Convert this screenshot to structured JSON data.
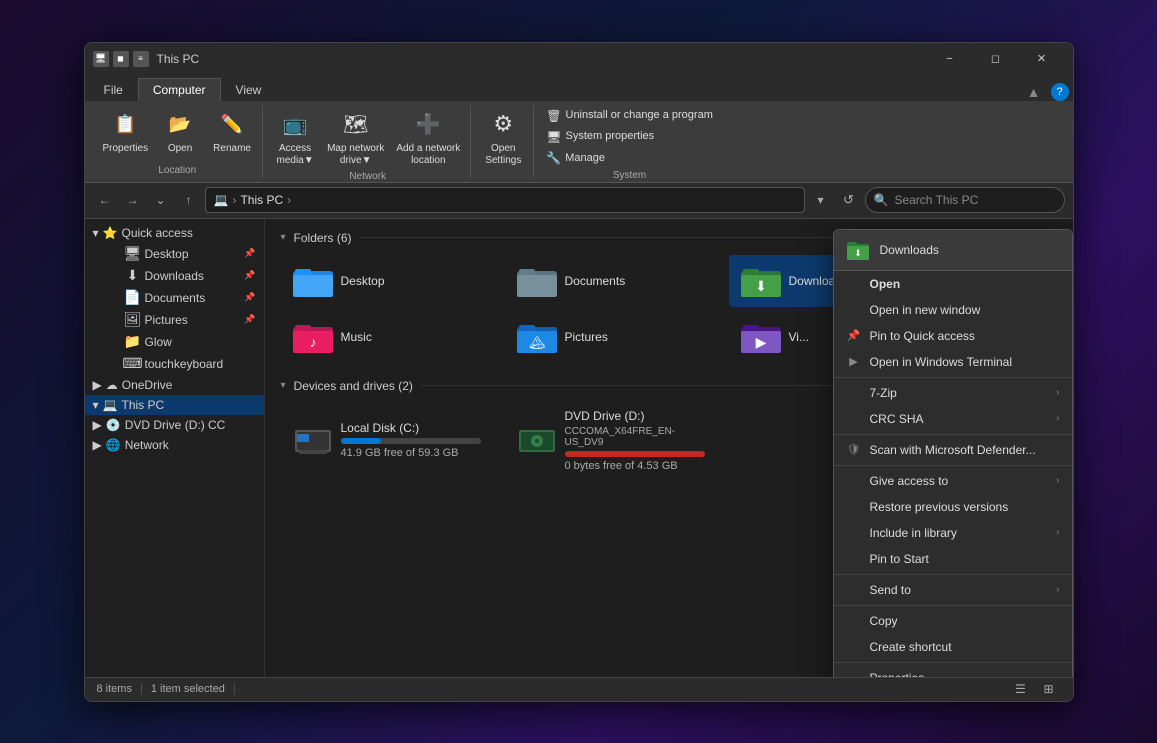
{
  "window": {
    "title": "This PC",
    "title_icon": "💻"
  },
  "ribbon_tabs": [
    {
      "label": "File",
      "active": false
    },
    {
      "label": "Computer",
      "active": true
    },
    {
      "label": "View",
      "active": false
    }
  ],
  "ribbon": {
    "location_group": {
      "label": "Location",
      "items": [
        {
          "icon": "📋",
          "label": "Properties"
        },
        {
          "icon": "📂",
          "label": "Open"
        },
        {
          "icon": "✏️",
          "label": "Rename"
        }
      ]
    },
    "network_group": {
      "label": "Network",
      "items": [
        {
          "icon": "🖥",
          "label": "Access media▼"
        },
        {
          "icon": "🗺",
          "label": "Map network drive▼"
        },
        {
          "icon": "➕",
          "label": "Add a network location"
        }
      ]
    },
    "settings_group": {
      "label": "",
      "items": [
        {
          "icon": "⚙",
          "label": "Open Settings"
        }
      ]
    },
    "system_group": {
      "label": "System",
      "items": [
        {
          "text": "🗑 Uninstall or change a program"
        },
        {
          "text": "🖥 System properties"
        },
        {
          "text": "🔧 Manage"
        }
      ]
    }
  },
  "address_bar": {
    "path_parts": [
      "💻",
      "This PC",
      ">"
    ],
    "search_placeholder": "Search This PC"
  },
  "sidebar": {
    "items": [
      {
        "level": 0,
        "expanded": true,
        "icon": "⭐",
        "label": "Quick access",
        "type": "section"
      },
      {
        "level": 1,
        "icon": "🖥",
        "label": "Desktop",
        "pin": true
      },
      {
        "level": 1,
        "icon": "⬇",
        "label": "Downloads",
        "pin": true
      },
      {
        "level": 1,
        "icon": "📄",
        "label": "Documents",
        "pin": true
      },
      {
        "level": 1,
        "icon": "🖼",
        "label": "Pictures",
        "pin": true
      },
      {
        "level": 1,
        "icon": "📁",
        "label": "Glow"
      },
      {
        "level": 1,
        "icon": "⌨",
        "label": "touchkeyboard"
      },
      {
        "level": 0,
        "expanded": false,
        "icon": "☁",
        "label": "OneDrive",
        "type": "section"
      },
      {
        "level": 0,
        "expanded": true,
        "icon": "💻",
        "label": "This PC",
        "type": "section",
        "selected": true
      },
      {
        "level": 0,
        "expanded": false,
        "icon": "💿",
        "label": "DVD Drive (D:) CC",
        "type": "section"
      },
      {
        "level": 0,
        "expanded": false,
        "icon": "🌐",
        "label": "Network",
        "type": "section"
      }
    ]
  },
  "content": {
    "folders_section": "Folders (6)",
    "folders": [
      {
        "name": "Desktop",
        "icon_color": "#1e90ff"
      },
      {
        "name": "Documents",
        "icon_color": "#607d8b"
      },
      {
        "name": "Downloads",
        "icon_color": "#4caf50"
      },
      {
        "name": "Music",
        "icon_color": "#e91e63"
      },
      {
        "name": "Pictures",
        "icon_color": "#2196f3"
      },
      {
        "name": "Videos",
        "icon_color": "#7e57c2"
      }
    ],
    "drives_section": "Devices and drives (2)",
    "drives": [
      {
        "name": "Local Disk (C:)",
        "icon": "💾",
        "free": "41.9 GB free of 59.3 GB",
        "progress": 29
      },
      {
        "name": "DVD Drive (D:)",
        "sub": "CCCOMA_X64FRE_EN-US_DV9",
        "icon": "💿",
        "free": "0 bytes free of 4.53 GB",
        "progress": 100
      }
    ]
  },
  "context_menu": {
    "header": "Downloads",
    "items": [
      {
        "label": "Open",
        "bold": true,
        "icon": ""
      },
      {
        "label": "Open in new window",
        "icon": ""
      },
      {
        "label": "Pin to Quick access",
        "icon": "📌"
      },
      {
        "label": "Open in Windows Terminal",
        "icon": "▶",
        "separator_before": false
      },
      {
        "label": "7-Zip",
        "icon": "",
        "has_arrow": true,
        "separator_before": true
      },
      {
        "label": "CRC SHA",
        "icon": "",
        "has_arrow": true
      },
      {
        "label": "Scan with Microsoft Defender...",
        "icon": "🛡",
        "separator_before": true
      },
      {
        "label": "Give access to",
        "icon": "",
        "has_arrow": true,
        "separator_before": true
      },
      {
        "label": "Restore previous versions",
        "icon": ""
      },
      {
        "label": "Include in library",
        "icon": "",
        "has_arrow": true
      },
      {
        "label": "Pin to Start",
        "icon": ""
      },
      {
        "label": "Send to",
        "icon": "",
        "has_arrow": true,
        "separator_before": true
      },
      {
        "label": "Copy",
        "icon": "",
        "separator_before": true
      },
      {
        "label": "Create shortcut",
        "icon": ""
      },
      {
        "label": "Properties",
        "icon": "",
        "separator_before": true
      }
    ]
  },
  "status_bar": {
    "items_count": "8 items",
    "selected": "1 item selected"
  }
}
